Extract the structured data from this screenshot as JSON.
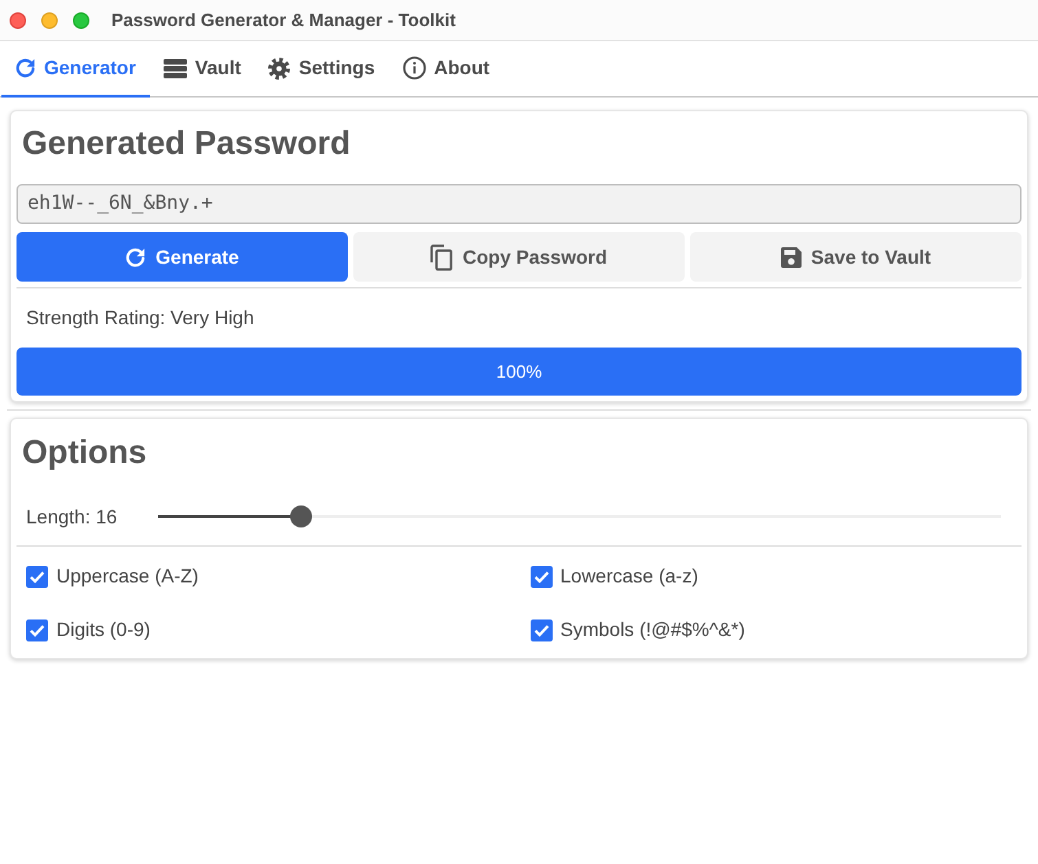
{
  "window": {
    "title": "Password Generator & Manager - Toolkit"
  },
  "tabs": [
    {
      "label": "Generator",
      "selected": true
    },
    {
      "label": "Vault",
      "selected": false
    },
    {
      "label": "Settings",
      "selected": false
    },
    {
      "label": "About",
      "selected": false
    }
  ],
  "generator": {
    "title": "Generated Password",
    "password": "eh1W--_6N_&Bny.+",
    "buttons": [
      {
        "label": "Generate",
        "kind": "primary"
      },
      {
        "label": "Copy Password",
        "kind": "secondary"
      },
      {
        "label": "Save to Vault",
        "kind": "secondary"
      }
    ],
    "strength": {
      "label": "Strength Rating: Very High",
      "level": 1,
      "reading": "100%"
    }
  },
  "options": {
    "title": "Options",
    "length": {
      "label": "Length: 16",
      "level": 0.17
    },
    "checkboxes": [
      {
        "label": "Uppercase (A-Z)",
        "checked": true
      },
      {
        "label": "Lowercase (a-z)",
        "checked": true
      },
      {
        "label": "Digits (0-9)",
        "checked": true
      },
      {
        "label": "Symbols (!@#$%^&*)",
        "checked": true
      }
    ]
  }
}
